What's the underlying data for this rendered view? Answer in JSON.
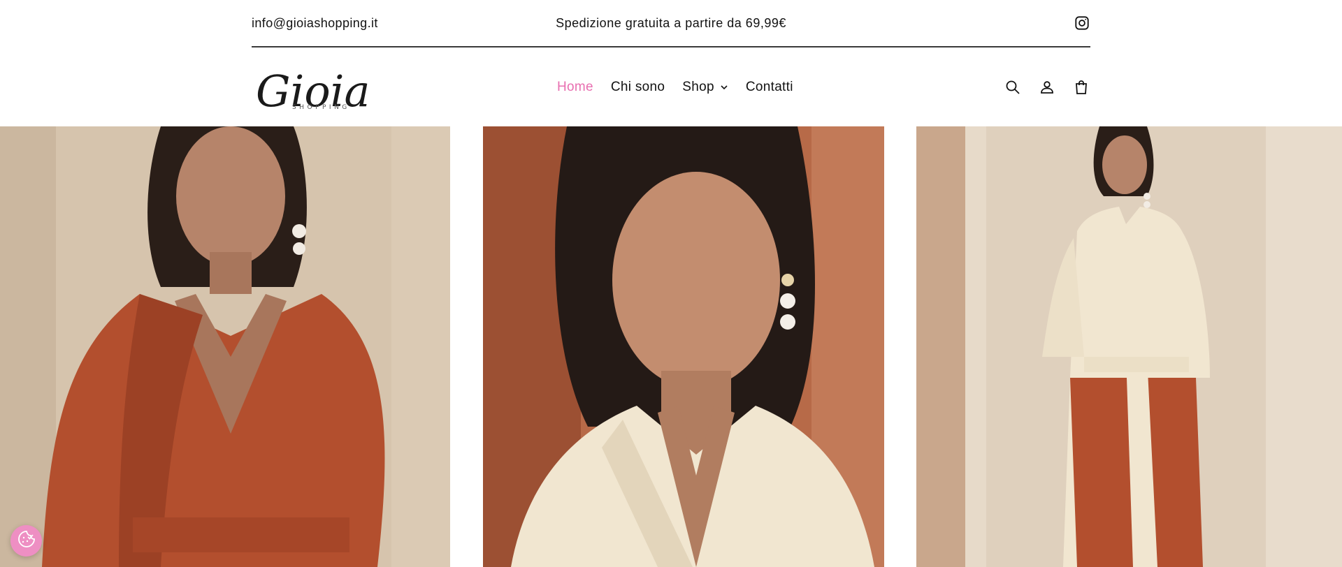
{
  "announcement": {
    "email": "info@gioiashopping.it",
    "shipping": "Spedizione gratuita a partire da 69,99€"
  },
  "logo": {
    "script": "Gioia",
    "tagline": "SHOPPING"
  },
  "nav": {
    "items": [
      {
        "label": "Home",
        "active": true
      },
      {
        "label": "Chi sono",
        "active": false
      },
      {
        "label": "Shop",
        "active": false,
        "dropdown": true
      },
      {
        "label": "Contatti",
        "active": false
      }
    ]
  },
  "header_icons": [
    "search-icon",
    "account-icon",
    "cart-icon"
  ],
  "gallery": {
    "images": [
      "woman-rust-wrap-jacket",
      "woman-cream-blazer-portrait",
      "woman-cream-jacket-rust-trousers"
    ]
  },
  "colors": {
    "accent_pink": "#e86fb0",
    "rust": "#b34f2e",
    "cream": "#f1e6d0"
  }
}
